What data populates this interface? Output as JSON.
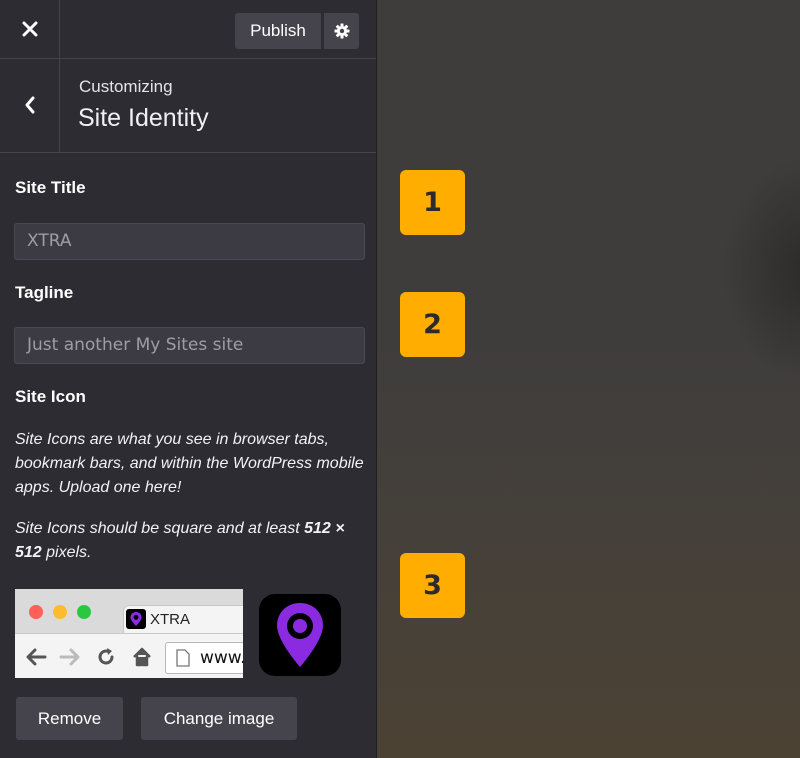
{
  "topbar": {
    "publish_label": "Publish"
  },
  "header": {
    "breadcrumb": "Customizing",
    "title": "Site Identity"
  },
  "site_title": {
    "label": "Site Title",
    "value": "XTRA"
  },
  "tagline": {
    "label": "Tagline",
    "placeholder": "Just another My Sites site"
  },
  "site_icon": {
    "label": "Site Icon",
    "description": "Site Icons are what you see in browser tabs, bookmark bars, and within the WordPress mobile apps. Upload one here!",
    "requirement_prefix": "Site Icons should be square and at least ",
    "requirement_size": "512 × 512",
    "requirement_suffix": " pixels.",
    "browser_tab_text": "XTRA",
    "browser_url": "www.",
    "remove_label": "Remove",
    "change_label": "Change image"
  },
  "badges": [
    "1",
    "2",
    "3"
  ],
  "colors": {
    "sidebar_bg": "#2d2c33",
    "badge": "#ffad00",
    "icon_purple": "#8a2be2"
  }
}
